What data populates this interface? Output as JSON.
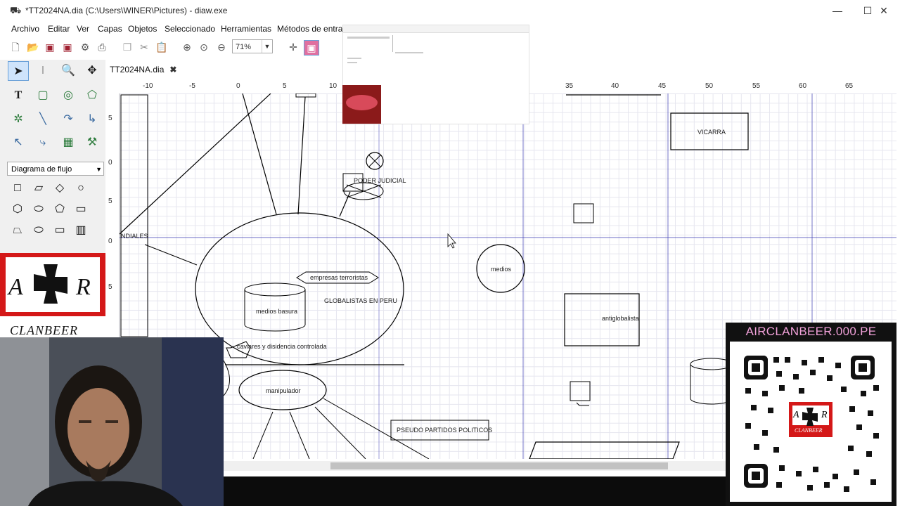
{
  "window": {
    "title": "*TT2024NA.dia (C:\\Users\\WINER\\Pictures) - diaw.exe",
    "controls": {
      "minimize": "—",
      "maximize": "☐",
      "close": "✕"
    }
  },
  "menu": [
    "Archivo",
    "Editar",
    "Ver",
    "Capas",
    "Objetos",
    "Seleccionado",
    "Herramientas",
    "Métodos de entrad"
  ],
  "toolbar": {
    "zoom_value": "71%"
  },
  "palette": {
    "sheet": "Diagrama de flujo"
  },
  "tab": {
    "label": "TT2024NA.dia",
    "close": "✖"
  },
  "ruler": {
    "h_ticks": [
      "-10",
      "-5",
      "0",
      "5",
      "10",
      "35",
      "40",
      "45",
      "50",
      "55",
      "60",
      "65"
    ],
    "v_ticks": [
      "5",
      "0",
      "5",
      "0",
      "5"
    ]
  },
  "diagram": {
    "labels": {
      "poder_judicial": "PODER JUDICIAL",
      "nidales": "NDIALES",
      "empresas": "empresas terroristas",
      "medios_basura": "medios basura",
      "globalistas": "GLOBALISTAS EN PERU",
      "caviares": "caviares y disidencia controlada",
      "manipulador": "manipulador",
      "pseudo": "PSEUDO PARTIDOS POLITICOS",
      "medios": "medios",
      "antiglobalista": "antiglobalista",
      "vicarra": "VICARRA"
    }
  },
  "overlay": {
    "logo_text": "CLANBEER",
    "logo_letters": [
      "A",
      "R"
    ],
    "qr_url": "AIRCLANBEER.000.PE"
  },
  "colors": {
    "accent": "#6aa0d8",
    "logo_red": "#d41818",
    "url_pink": "#f0a0d8"
  }
}
